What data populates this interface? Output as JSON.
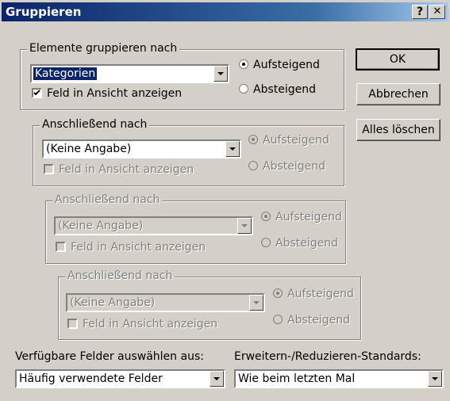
{
  "dialog": {
    "title": "Gruppieren",
    "help": "?",
    "close": "✕"
  },
  "groups": [
    {
      "legend": "Elemente gruppieren nach",
      "combo": "Kategorien",
      "checkbox": "Feld in Ansicht anzeigen",
      "asc": "Aufsteigend",
      "desc": "Absteigend",
      "enabled": true,
      "checked": true,
      "ascSelected": true
    },
    {
      "legend": "Anschließend nach",
      "combo": "(Keine Angabe)",
      "checkbox": "Feld in Ansicht anzeigen",
      "asc": "Aufsteigend",
      "desc": "Absteigend",
      "enabled": true,
      "checked": false,
      "ascSelected": true
    },
    {
      "legend": "Anschließend nach",
      "combo": "(Keine Angabe)",
      "checkbox": "Feld in Ansicht anzeigen",
      "asc": "Aufsteigend",
      "desc": "Absteigend",
      "enabled": false,
      "checked": false,
      "ascSelected": true
    },
    {
      "legend": "Anschließend nach",
      "combo": "(Keine Angabe)",
      "checkbox": "Feld in Ansicht anzeigen",
      "asc": "Aufsteigend",
      "desc": "Absteigend",
      "enabled": false,
      "checked": false,
      "ascSelected": true
    }
  ],
  "buttons": {
    "ok": "OK",
    "cancel": "Abbrechen",
    "clear": "Alles löschen"
  },
  "fields": {
    "label": "Verfügbare Felder auswählen aus:",
    "value": "Häufig verwendete Felder"
  },
  "expand": {
    "label": "Erweitern-/Reduzieren-Standards:",
    "value": "Wie beim letzten Mal"
  }
}
